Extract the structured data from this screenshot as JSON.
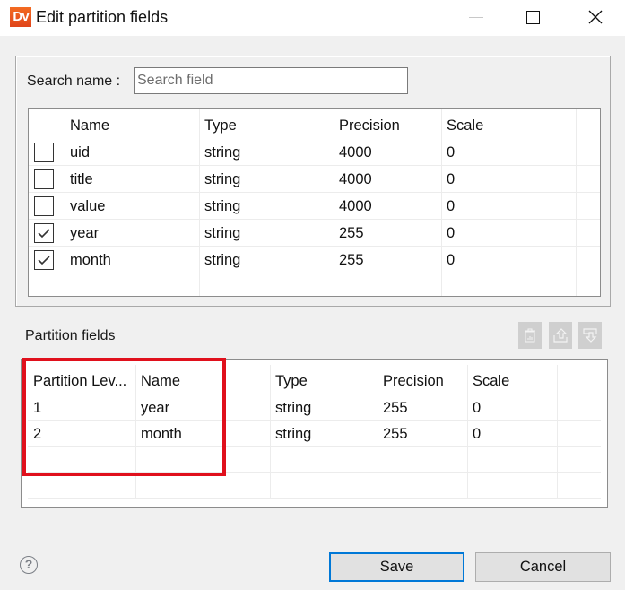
{
  "window": {
    "app_logo_text": "Dv",
    "title": "Edit partition fields",
    "controls": {
      "minimize": "minimize",
      "maximize": "maximize",
      "close": "close"
    }
  },
  "search": {
    "label": "Search name :",
    "value": "",
    "placeholder": "Search field"
  },
  "fields_table": {
    "columns": [
      "Name",
      "Type",
      "Precision",
      "Scale"
    ],
    "rows": [
      {
        "checked": false,
        "name": "uid",
        "type": "string",
        "precision": "4000",
        "scale": "0"
      },
      {
        "checked": false,
        "name": "title",
        "type": "string",
        "precision": "4000",
        "scale": "0"
      },
      {
        "checked": false,
        "name": "value",
        "type": "string",
        "precision": "4000",
        "scale": "0"
      },
      {
        "checked": true,
        "name": "year",
        "type": "string",
        "precision": "255",
        "scale": "0"
      },
      {
        "checked": true,
        "name": "month",
        "type": "string",
        "precision": "255",
        "scale": "0"
      }
    ]
  },
  "partition_section": {
    "label": "Partition fields",
    "toolbar": {
      "delete": "delete-icon",
      "move_up": "move-up-icon",
      "move_down": "move-down-icon"
    },
    "columns": [
      "Partition Lev...",
      "Name",
      "Type",
      "Precision",
      "Scale"
    ],
    "rows": [
      {
        "level": "1",
        "name": "year",
        "type": "string",
        "precision": "255",
        "scale": "0"
      },
      {
        "level": "2",
        "name": "month",
        "type": "string",
        "precision": "255",
        "scale": "0"
      }
    ]
  },
  "annotation": {
    "highlight_color": "#e0101c"
  },
  "footer": {
    "help_glyph": "?",
    "save_label": "Save",
    "cancel_label": "Cancel"
  }
}
